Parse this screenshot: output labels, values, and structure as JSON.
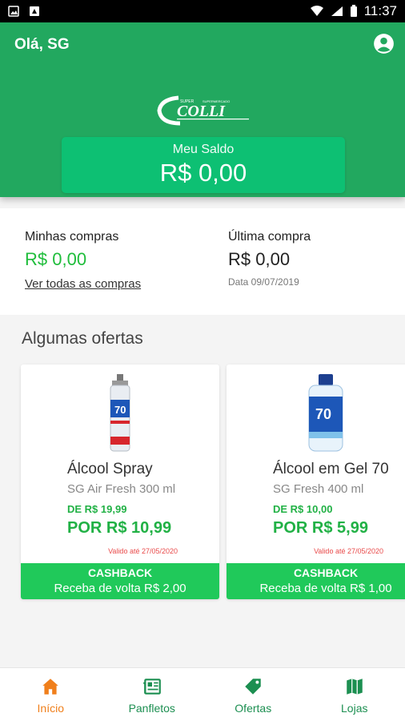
{
  "status_bar": {
    "time": "11:37"
  },
  "header": {
    "greeting": "Olá, SG",
    "balance_label": "Meu Saldo",
    "balance_value": "R$ 0,00"
  },
  "purchases": {
    "my_purchases_label": "Minhas compras",
    "my_purchases_value": "R$ 0,00",
    "see_all_link": "Ver todas as compras",
    "last_purchase_label": "Última compra",
    "last_purchase_value": "R$ 0,00",
    "last_purchase_date": "Data 09/07/2019"
  },
  "offers": {
    "title": "Algumas ofertas",
    "items": [
      {
        "name": "Álcool Spray",
        "description": "SG Air Fresh 300 ml",
        "old_price": "DE R$ 19,99",
        "new_price": "POR R$ 10,99",
        "valid_until": "Valido até 27/05/2020",
        "cashback_title": "CASHBACK",
        "cashback_text": "Receba de volta R$ 2,00"
      },
      {
        "name": "Álcool em Gel 70",
        "description": "SG Fresh 400 ml",
        "old_price": "DE R$ 10,00",
        "new_price": "POR R$ 5,99",
        "valid_until": "Valido até 27/05/2020",
        "cashback_title": "CASHBACK",
        "cashback_text": "Receba de volta R$ 1,00"
      }
    ]
  },
  "bottom_nav": [
    {
      "label": "Início",
      "icon": "home-icon",
      "active": true
    },
    {
      "label": "Panfletos",
      "icon": "newspaper-icon",
      "active": false
    },
    {
      "label": "Ofertas",
      "icon": "tag-icon",
      "active": false
    },
    {
      "label": "Lojas",
      "icon": "map-icon",
      "active": false
    }
  ],
  "colors": {
    "header_green": "#22a85f",
    "card_green": "#0dc073",
    "price_green": "#21b145",
    "cashback_green": "#20c95a",
    "active_orange": "#f07f1b"
  }
}
